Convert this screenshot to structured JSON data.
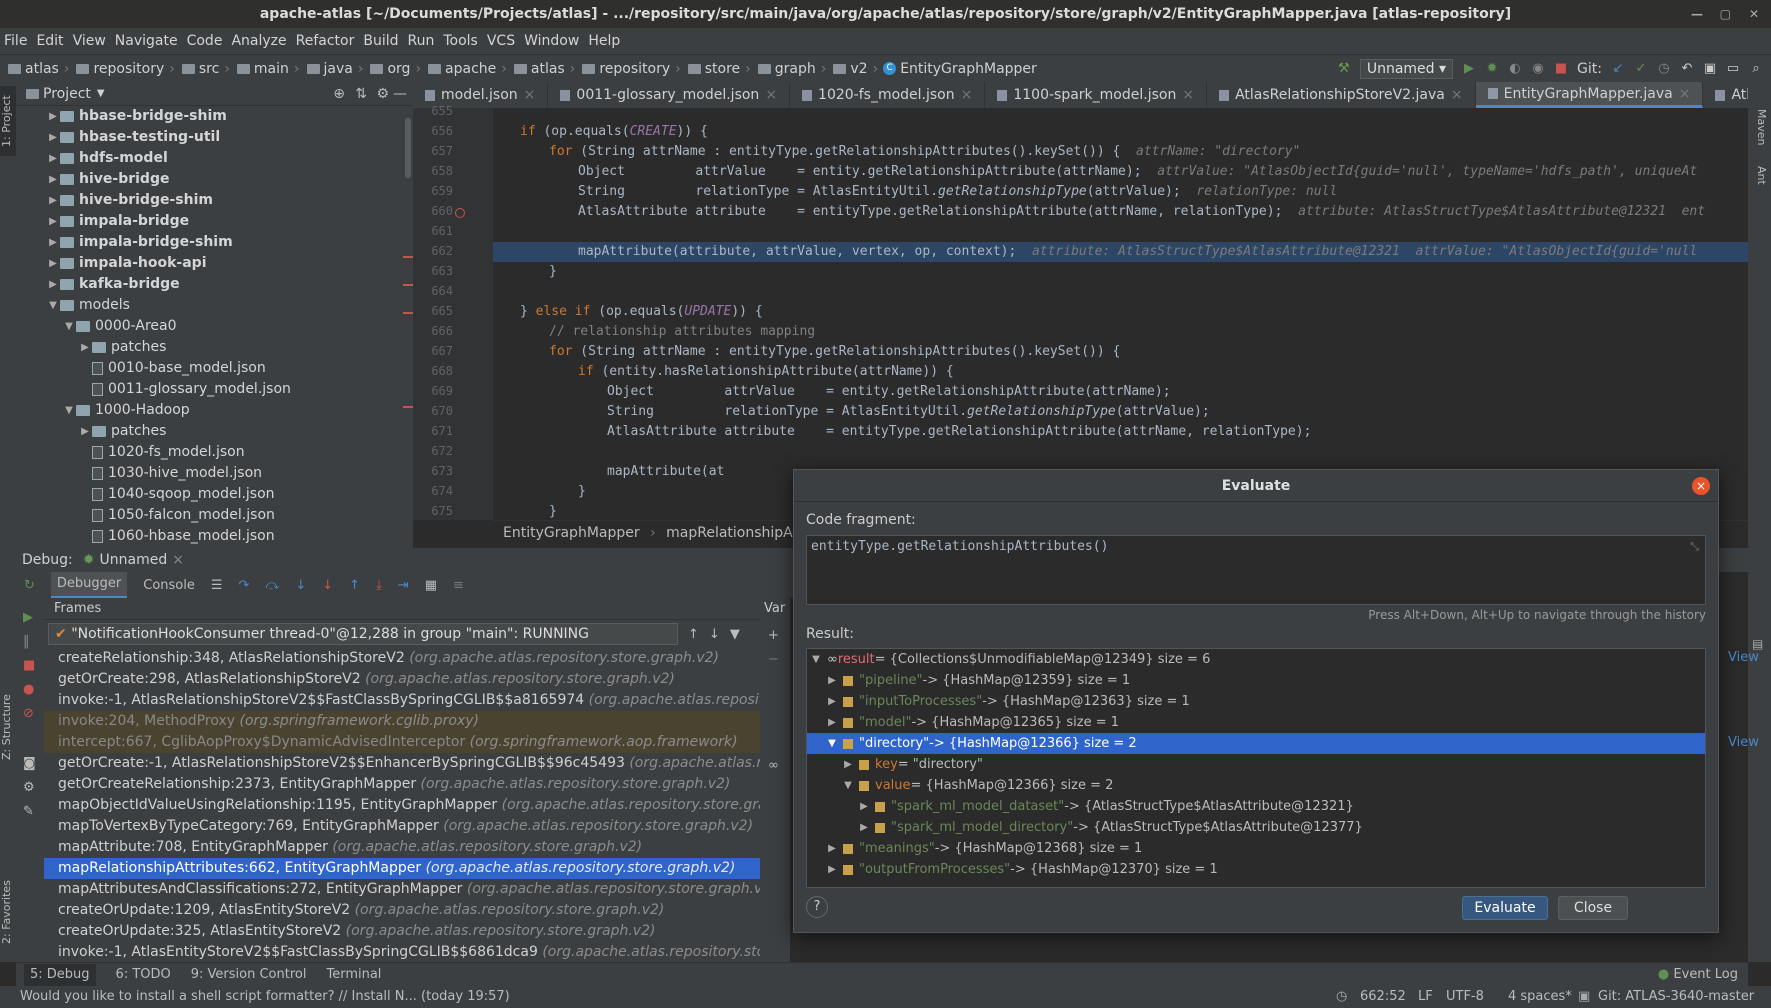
{
  "window": {
    "title": "apache-atlas [~/Documents/Projects/atlas] - .../repository/src/main/java/org/apache/atlas/repository/store/graph/v2/EntityGraphMapper.java [atlas-repository]"
  },
  "menu": [
    "File",
    "Edit",
    "View",
    "Navigate",
    "Code",
    "Analyze",
    "Refactor",
    "Build",
    "Run",
    "Tools",
    "VCS",
    "Window",
    "Help"
  ],
  "nav": {
    "crumbs": [
      "atlas",
      "repository",
      "src",
      "main",
      "java",
      "org",
      "apache",
      "atlas",
      "repository",
      "store",
      "graph",
      "v2"
    ],
    "current": "EntityGraphMapper",
    "run_config": "Unnamed",
    "git_label": "Git:"
  },
  "project": {
    "title": "Project",
    "items": [
      {
        "label": "hbase-bridge-shim",
        "indent": 1,
        "tri": "▶",
        "kind": "mod"
      },
      {
        "label": "hbase-testing-util",
        "indent": 1,
        "tri": "▶",
        "kind": "mod"
      },
      {
        "label": "hdfs-model",
        "indent": 1,
        "tri": "▶",
        "kind": "mod"
      },
      {
        "label": "hive-bridge",
        "indent": 1,
        "tri": "▶",
        "kind": "mod"
      },
      {
        "label": "hive-bridge-shim",
        "indent": 1,
        "tri": "▶",
        "kind": "mod"
      },
      {
        "label": "impala-bridge",
        "indent": 1,
        "tri": "▶",
        "kind": "mod"
      },
      {
        "label": "impala-bridge-shim",
        "indent": 1,
        "tri": "▶",
        "kind": "mod"
      },
      {
        "label": "impala-hook-api",
        "indent": 1,
        "tri": "▶",
        "kind": "mod"
      },
      {
        "label": "kafka-bridge",
        "indent": 1,
        "tri": "▶",
        "kind": "mod"
      },
      {
        "label": "models",
        "indent": 1,
        "tri": "▼",
        "kind": "dir"
      },
      {
        "label": "0000-Area0",
        "indent": 2,
        "tri": "▼",
        "kind": "dir"
      },
      {
        "label": "patches",
        "indent": 3,
        "tri": "▶",
        "kind": "dir"
      },
      {
        "label": "0010-base_model.json",
        "indent": 3,
        "tri": "",
        "kind": "file"
      },
      {
        "label": "0011-glossary_model.json",
        "indent": 3,
        "tri": "",
        "kind": "file"
      },
      {
        "label": "1000-Hadoop",
        "indent": 2,
        "tri": "▼",
        "kind": "dir"
      },
      {
        "label": "patches",
        "indent": 3,
        "tri": "▶",
        "kind": "dir"
      },
      {
        "label": "1020-fs_model.json",
        "indent": 3,
        "tri": "",
        "kind": "file"
      },
      {
        "label": "1030-hive_model.json",
        "indent": 3,
        "tri": "",
        "kind": "file"
      },
      {
        "label": "1040-sqoop_model.json",
        "indent": 3,
        "tri": "",
        "kind": "file"
      },
      {
        "label": "1050-falcon_model.json",
        "indent": 3,
        "tri": "",
        "kind": "file"
      },
      {
        "label": "1060-hbase_model.json",
        "indent": 3,
        "tri": "",
        "kind": "file"
      }
    ]
  },
  "tabs": [
    {
      "label": "model.json",
      "active": false
    },
    {
      "label": "0011-glossary_model.json",
      "active": false
    },
    {
      "label": "1020-fs_model.json",
      "active": false
    },
    {
      "label": "1100-spark_model.json",
      "active": false
    },
    {
      "label": "AtlasRelationshipStoreV2.java",
      "active": false
    },
    {
      "label": "EntityGraphMapper.java",
      "active": true
    },
    {
      "label": "AtlasEntityType.java",
      "active": false
    }
  ],
  "code_lines": [
    {
      "n": "655",
      "i": 0,
      "html": ""
    },
    {
      "n": "656",
      "i": 3,
      "html": "<span class='kw'>if</span> (op.equals(<span class='it'>CREATE</span>)) {"
    },
    {
      "n": "657",
      "i": 4,
      "html": "<span class='kw'>for</span> (String attrName : entityType.getRelationshipAttributes().keySet()) {  <span class='hint'>attrName: \"directory\"</span>"
    },
    {
      "n": "658",
      "i": 5,
      "html": "Object         attrValue    = entity.getRelationshipAttribute(attrName);  <span class='hint'>attrValue: \"AtlasObjectId{guid='null', typeName='hdfs_path', uniqueAt</span>"
    },
    {
      "n": "659",
      "i": 5,
      "html": "String         relationType = AtlasEntityUtil.<span class='im'>getRelationshipType</span>(attrValue);  <span class='hint'>relationType: null</span>"
    },
    {
      "n": "660",
      "i": 5,
      "html": "AtlasAttribute attribute    = entityType.getRelationshipAttribute(attrName, relationType);  <span class='hint'>attribute: AtlasStructType$AtlasAttribute@12321  ent</span>"
    },
    {
      "n": "661",
      "i": 0,
      "html": ""
    },
    {
      "n": "662",
      "i": 5,
      "html": "mapAttribute(attribute, attrValue, vertex, op, context);  <span class='hint'>attribute: AtlasStructType$AtlasAttribute@12321  attrValue: \"AtlasObjectId{guid='null</span>"
    },
    {
      "n": "663",
      "i": 4,
      "html": "}"
    },
    {
      "n": "664",
      "i": 0,
      "html": ""
    },
    {
      "n": "665",
      "i": 3,
      "html": "} <span class='kw'>else if</span> (op.equals(<span class='it'>UPDATE</span>)) {"
    },
    {
      "n": "666",
      "i": 4,
      "html": "<span class='cm'>// relationship attributes mapping</span>"
    },
    {
      "n": "667",
      "i": 4,
      "html": "<span class='kw'>for</span> (String attrName : entityType.getRelationshipAttributes().keySet()) {"
    },
    {
      "n": "668",
      "i": 5,
      "html": "<span class='kw'>if</span> (entity.hasRelationshipAttribute(attrName)) {"
    },
    {
      "n": "669",
      "i": 6,
      "html": "Object         attrValue    = entity.getRelationshipAttribute(attrName);"
    },
    {
      "n": "670",
      "i": 6,
      "html": "String         relationType = AtlasEntityUtil.<span class='im'>getRelationshipType</span>(attrValue);"
    },
    {
      "n": "671",
      "i": 6,
      "html": "AtlasAttribute attribute    = entityType.getRelationshipAttribute(attrName, relationType);"
    },
    {
      "n": "672",
      "i": 0,
      "html": ""
    },
    {
      "n": "673",
      "i": 6,
      "html": "mapAttribute(at"
    },
    {
      "n": "674",
      "i": 5,
      "html": "}"
    },
    {
      "n": "675",
      "i": 4,
      "html": "}"
    }
  ],
  "editor_crumbs": {
    "a": "EntityGraphMapper",
    "b": "mapRelationshipAttri"
  },
  "debug": {
    "label": "Debug:",
    "config": "Unnamed",
    "tab_debugger": "Debugger",
    "tab_console": "Console",
    "frames_label": "Frames",
    "vars_label": "Var",
    "thread": "\"NotificationHookConsumer thread-0\"@12,288 in group \"main\": RUNNING",
    "frames": [
      {
        "m": "createRelationship:348, AtlasRelationshipStoreV2",
        "p": "(org.apache.atlas.repository.store.graph.v2)",
        "t": ""
      },
      {
        "m": "getOrCreate:298, AtlasRelationshipStoreV2",
        "p": "(org.apache.atlas.repository.store.graph.v2)",
        "t": ""
      },
      {
        "m": "invoke:-1, AtlasRelationshipStoreV2$$FastClassBySpringCGLIB$$a8165974",
        "p": "(org.apache.atlas.repository.stor",
        "t": ""
      },
      {
        "m": "invoke:204, MethodProxy",
        "p": "(org.springframework.cglib.proxy)",
        "t": "lib"
      },
      {
        "m": "intercept:667, CglibAopProxy$DynamicAdvisedInterceptor",
        "p": "(org.springframework.aop.framework)",
        "t": "lib"
      },
      {
        "m": "getOrCreate:-1, AtlasRelationshipStoreV2$$EnhancerBySpringCGLIB$$96c45493",
        "p": "(org.apache.atlas.repositor",
        "t": ""
      },
      {
        "m": "getOrCreateRelationship:2373, EntityGraphMapper",
        "p": "(org.apache.atlas.repository.store.graph.v2)",
        "t": ""
      },
      {
        "m": "mapObjectIdValueUsingRelationship:1195, EntityGraphMapper",
        "p": "(org.apache.atlas.repository.store.graph.v2)",
        "t": ""
      },
      {
        "m": "mapToVertexByTypeCategory:769, EntityGraphMapper",
        "p": "(org.apache.atlas.repository.store.graph.v2)",
        "t": ""
      },
      {
        "m": "mapAttribute:708, EntityGraphMapper",
        "p": "(org.apache.atlas.repository.store.graph.v2)",
        "t": ""
      },
      {
        "m": "mapRelationshipAttributes:662, EntityGraphMapper",
        "p": "(org.apache.atlas.repository.store.graph.v2)",
        "t": "sel"
      },
      {
        "m": "mapAttributesAndClassifications:272, EntityGraphMapper",
        "p": "(org.apache.atlas.repository.store.graph.v2)",
        "t": ""
      },
      {
        "m": "createOrUpdate:1209, AtlasEntityStoreV2",
        "p": "(org.apache.atlas.repository.store.graph.v2)",
        "t": ""
      },
      {
        "m": "createOrUpdate:325, AtlasEntityStoreV2",
        "p": "(org.apache.atlas.repository.store.graph.v2)",
        "t": ""
      },
      {
        "m": "invoke:-1, AtlasEntityStoreV2$$FastClassBySpringCGLIB$$6861dca9",
        "p": "(org.apache.atlas.repository.store.graph",
        "t": ""
      }
    ]
  },
  "evaluate": {
    "title": "Evaluate",
    "code_label": "Code fragment:",
    "code": "entityType.getRelationshipAttributes()",
    "history_hint": "Press Alt+Down, Alt+Up to navigate through the history",
    "result_label": "Result:",
    "rows": [
      {
        "lvl": 0,
        "tri": "▼",
        "name": "result",
        "rest": " = {Collections$UnmodifiableMap@12349}  size = 6",
        "kind": "result"
      },
      {
        "lvl": 1,
        "tri": "▶",
        "name": "\"pipeline\"",
        "rest": " -> {HashMap@12359}  size = 1",
        "kind": "str"
      },
      {
        "lvl": 1,
        "tri": "▶",
        "name": "\"inputToProcesses\"",
        "rest": " -> {HashMap@12363}  size = 1",
        "kind": "str"
      },
      {
        "lvl": 1,
        "tri": "▶",
        "name": "\"model\"",
        "rest": " -> {HashMap@12365}  size = 1",
        "kind": "str"
      },
      {
        "lvl": 1,
        "tri": "▼",
        "name": "\"directory\"",
        "rest": " -> {HashMap@12366}  size = 2",
        "kind": "sel"
      },
      {
        "lvl": 2,
        "tri": "▶",
        "name": "key",
        "rest": " = \"directory\"",
        "kind": "key"
      },
      {
        "lvl": 2,
        "tri": "▼",
        "name": "value",
        "rest": " = {HashMap@12366}  size = 2",
        "kind": "key"
      },
      {
        "lvl": 3,
        "tri": "▶",
        "name": "\"spark_ml_model_dataset\"",
        "rest": " -> {AtlasStructType$AtlasAttribute@12321}",
        "kind": "str"
      },
      {
        "lvl": 3,
        "tri": "▶",
        "name": "\"spark_ml_model_directory\"",
        "rest": " -> {AtlasStructType$AtlasAttribute@12377}",
        "kind": "str"
      },
      {
        "lvl": 1,
        "tri": "▶",
        "name": "\"meanings\"",
        "rest": " -> {HashMap@12368}  size = 1",
        "kind": "str"
      },
      {
        "lvl": 1,
        "tri": "▶",
        "name": "\"outputFromProcesses\"",
        "rest": " -> {HashMap@12370}  size = 1",
        "kind": "str"
      }
    ],
    "btn_evaluate": "Evaluate",
    "btn_close": "Close",
    "help": "?"
  },
  "side_view_1": "View",
  "side_view_2": "View",
  "bottom_tabs": [
    "5: Debug",
    "6: TODO",
    "9: Version Control",
    "Terminal"
  ],
  "event_log": "Event Log",
  "status": {
    "message": "Would you like to install a shell script formatter? // Install   N... (today 19:57)",
    "position": "662:52",
    "lf": "LF",
    "enc": "UTF-8",
    "indent": "4 spaces*",
    "git": "Git: ATLAS-3640-master"
  },
  "left_strip": {
    "project": "1: Project",
    "structure": "Z: Structure",
    "favorites": "2: Favorites"
  },
  "right_strip": {
    "maven": "Maven",
    "ant": "Ant"
  }
}
